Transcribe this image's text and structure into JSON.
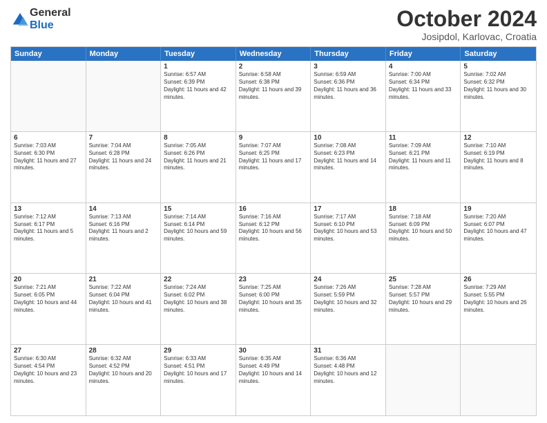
{
  "header": {
    "logo_general": "General",
    "logo_blue": "Blue",
    "month_title": "October 2024",
    "location": "Josipdol, Karlovac, Croatia"
  },
  "days_of_week": [
    "Sunday",
    "Monday",
    "Tuesday",
    "Wednesday",
    "Thursday",
    "Friday",
    "Saturday"
  ],
  "weeks": [
    [
      {
        "day": "",
        "info": ""
      },
      {
        "day": "",
        "info": ""
      },
      {
        "day": "1",
        "info": "Sunrise: 6:57 AM\nSunset: 6:39 PM\nDaylight: 11 hours and 42 minutes."
      },
      {
        "day": "2",
        "info": "Sunrise: 6:58 AM\nSunset: 6:38 PM\nDaylight: 11 hours and 39 minutes."
      },
      {
        "day": "3",
        "info": "Sunrise: 6:59 AM\nSunset: 6:36 PM\nDaylight: 11 hours and 36 minutes."
      },
      {
        "day": "4",
        "info": "Sunrise: 7:00 AM\nSunset: 6:34 PM\nDaylight: 11 hours and 33 minutes."
      },
      {
        "day": "5",
        "info": "Sunrise: 7:02 AM\nSunset: 6:32 PM\nDaylight: 11 hours and 30 minutes."
      }
    ],
    [
      {
        "day": "6",
        "info": "Sunrise: 7:03 AM\nSunset: 6:30 PM\nDaylight: 11 hours and 27 minutes."
      },
      {
        "day": "7",
        "info": "Sunrise: 7:04 AM\nSunset: 6:28 PM\nDaylight: 11 hours and 24 minutes."
      },
      {
        "day": "8",
        "info": "Sunrise: 7:05 AM\nSunset: 6:26 PM\nDaylight: 11 hours and 21 minutes."
      },
      {
        "day": "9",
        "info": "Sunrise: 7:07 AM\nSunset: 6:25 PM\nDaylight: 11 hours and 17 minutes."
      },
      {
        "day": "10",
        "info": "Sunrise: 7:08 AM\nSunset: 6:23 PM\nDaylight: 11 hours and 14 minutes."
      },
      {
        "day": "11",
        "info": "Sunrise: 7:09 AM\nSunset: 6:21 PM\nDaylight: 11 hours and 11 minutes."
      },
      {
        "day": "12",
        "info": "Sunrise: 7:10 AM\nSunset: 6:19 PM\nDaylight: 11 hours and 8 minutes."
      }
    ],
    [
      {
        "day": "13",
        "info": "Sunrise: 7:12 AM\nSunset: 6:17 PM\nDaylight: 11 hours and 5 minutes."
      },
      {
        "day": "14",
        "info": "Sunrise: 7:13 AM\nSunset: 6:16 PM\nDaylight: 11 hours and 2 minutes."
      },
      {
        "day": "15",
        "info": "Sunrise: 7:14 AM\nSunset: 6:14 PM\nDaylight: 10 hours and 59 minutes."
      },
      {
        "day": "16",
        "info": "Sunrise: 7:16 AM\nSunset: 6:12 PM\nDaylight: 10 hours and 56 minutes."
      },
      {
        "day": "17",
        "info": "Sunrise: 7:17 AM\nSunset: 6:10 PM\nDaylight: 10 hours and 53 minutes."
      },
      {
        "day": "18",
        "info": "Sunrise: 7:18 AM\nSunset: 6:09 PM\nDaylight: 10 hours and 50 minutes."
      },
      {
        "day": "19",
        "info": "Sunrise: 7:20 AM\nSunset: 6:07 PM\nDaylight: 10 hours and 47 minutes."
      }
    ],
    [
      {
        "day": "20",
        "info": "Sunrise: 7:21 AM\nSunset: 6:05 PM\nDaylight: 10 hours and 44 minutes."
      },
      {
        "day": "21",
        "info": "Sunrise: 7:22 AM\nSunset: 6:04 PM\nDaylight: 10 hours and 41 minutes."
      },
      {
        "day": "22",
        "info": "Sunrise: 7:24 AM\nSunset: 6:02 PM\nDaylight: 10 hours and 38 minutes."
      },
      {
        "day": "23",
        "info": "Sunrise: 7:25 AM\nSunset: 6:00 PM\nDaylight: 10 hours and 35 minutes."
      },
      {
        "day": "24",
        "info": "Sunrise: 7:26 AM\nSunset: 5:59 PM\nDaylight: 10 hours and 32 minutes."
      },
      {
        "day": "25",
        "info": "Sunrise: 7:28 AM\nSunset: 5:57 PM\nDaylight: 10 hours and 29 minutes."
      },
      {
        "day": "26",
        "info": "Sunrise: 7:29 AM\nSunset: 5:55 PM\nDaylight: 10 hours and 26 minutes."
      }
    ],
    [
      {
        "day": "27",
        "info": "Sunrise: 6:30 AM\nSunset: 4:54 PM\nDaylight: 10 hours and 23 minutes."
      },
      {
        "day": "28",
        "info": "Sunrise: 6:32 AM\nSunset: 4:52 PM\nDaylight: 10 hours and 20 minutes."
      },
      {
        "day": "29",
        "info": "Sunrise: 6:33 AM\nSunset: 4:51 PM\nDaylight: 10 hours and 17 minutes."
      },
      {
        "day": "30",
        "info": "Sunrise: 6:35 AM\nSunset: 4:49 PM\nDaylight: 10 hours and 14 minutes."
      },
      {
        "day": "31",
        "info": "Sunrise: 6:36 AM\nSunset: 4:48 PM\nDaylight: 10 hours and 12 minutes."
      },
      {
        "day": "",
        "info": ""
      },
      {
        "day": "",
        "info": ""
      }
    ]
  ]
}
